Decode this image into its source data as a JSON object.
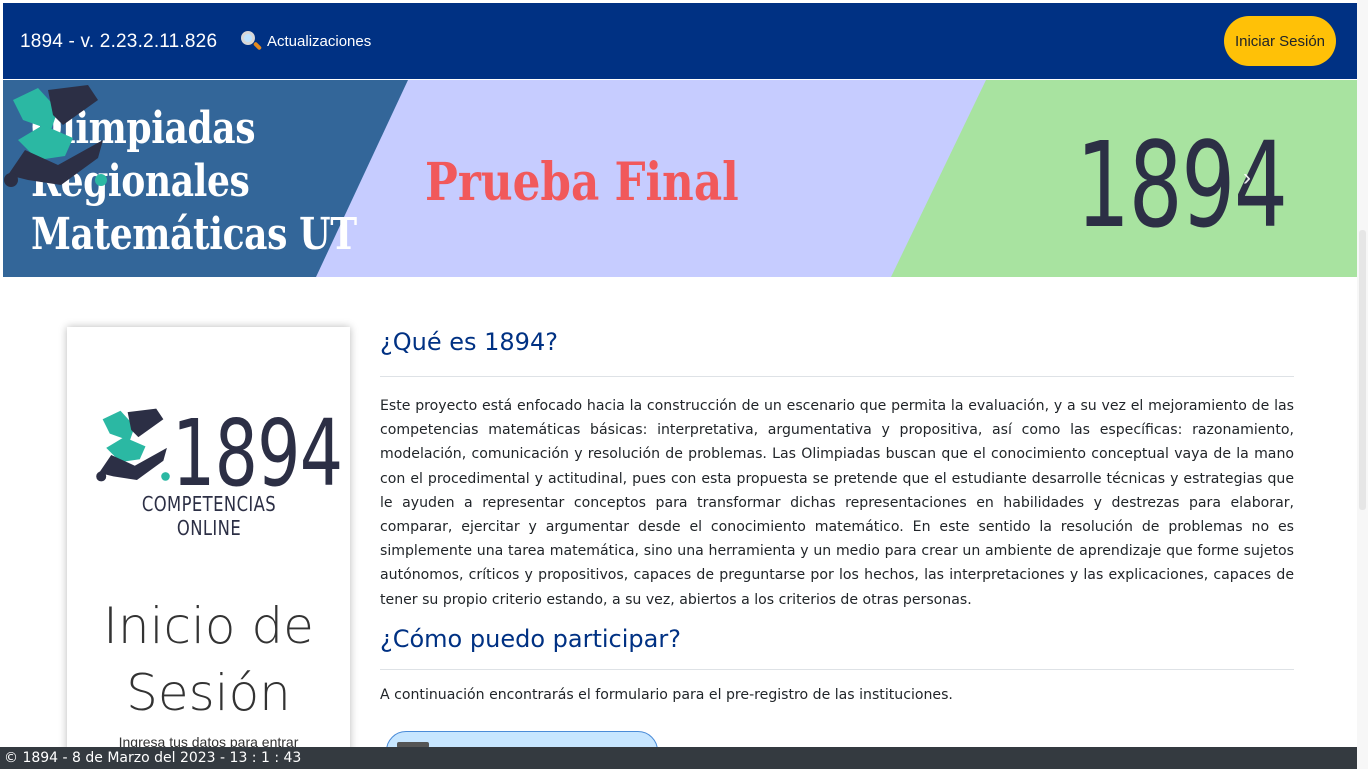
{
  "navbar": {
    "brand": "1894 - v. 2.23.2.11.826",
    "updates_label": "Actualizaciones",
    "login_button": "Iniciar Sesión"
  },
  "banner": {
    "title_lines": [
      "Olimpiadas",
      "Regionales",
      "Matemáticas UT"
    ],
    "subtitle": "Prueba Final",
    "logo_number": "1894",
    "next_arrow": "›",
    "colors": {
      "left": "#336699",
      "middle": "#c6ccff",
      "right": "#a8e3a0",
      "subtitle": "#f1595b"
    }
  },
  "login_card": {
    "logo_number": "1894",
    "logo_tagline": "COMPETENCIAS ONLINE",
    "title": "Inicio de Sesión",
    "hint": "Ingresa tus datos para entrar"
  },
  "main": {
    "section1_title": "¿Qué es 1894?",
    "section1_text": "Este proyecto está enfocado hacia la construcción de un escenario que permita la evaluación, y a su vez el mejoramiento de las competencias matemáticas básicas: interpretativa, argumentativa y propositiva, así como las específicas: razonamiento, modelación, comunicación y resolución de problemas. Las Olimpiadas buscan que el conocimiento conceptual vaya de la mano con el procedimental y actitudinal, pues con esta propuesta se pretende que el estudiante desarrolle técnicas y estrategias que le ayuden a representar conceptos para transformar dichas representaciones en habilidades y destrezas para elaborar, comparar, ejercitar y argumentar desde el conocimiento matemático. En este sentido la resolución de problemas no es simplemente una tarea matemática, sino una herramienta y un medio para crear un ambiente de aprendizaje que forme sujetos autónomos, críticos y propositivos, capaces de preguntarse por los hechos, las interpretaciones y las explicaciones, capaces de tener su propio criterio estando, a su vez, abiertos a los criterios de otras personas.",
    "section2_title": "¿Cómo puedo participar?",
    "section2_text": "A continuación encontrarás el formulario para el pre-registro de las instituciones."
  },
  "footer": {
    "text": "© 1894 - 8 de Marzo del 2023 - 13 : 1 : 43"
  },
  "colors": {
    "navbar": "#003183",
    "accent": "#ffc107",
    "heading": "#003183",
    "footer": "#343a40"
  },
  "icons": [
    "magnifier-icon",
    "chevron-right-icon",
    "logo-1894-icon"
  ]
}
